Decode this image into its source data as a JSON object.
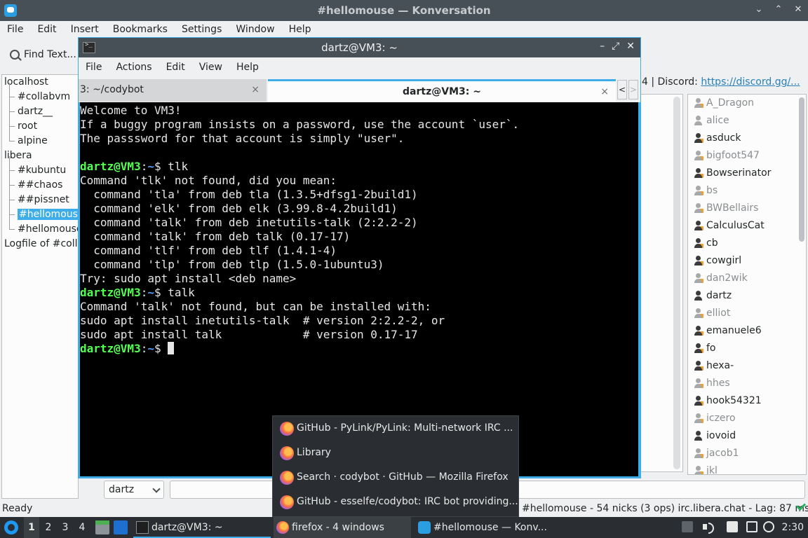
{
  "konversation": {
    "title": "#hellomouse — Konversation",
    "menu": [
      "File",
      "Edit",
      "Insert",
      "Bookmarks",
      "Settings",
      "Window",
      "Help"
    ],
    "find_text": "Find Text...",
    "tree": [
      {
        "label": "localhost",
        "level": "top"
      },
      {
        "label": "#collabvm",
        "level": "child"
      },
      {
        "label": "dartz__",
        "level": "child"
      },
      {
        "label": "root",
        "level": "child"
      },
      {
        "label": "alpine",
        "level": "child"
      },
      {
        "label": "libera",
        "level": "top"
      },
      {
        "label": "#kubuntu",
        "level": "child"
      },
      {
        "label": "##chaos",
        "level": "child"
      },
      {
        "label": "##pissnet",
        "level": "child"
      },
      {
        "label": "#hellomouse",
        "level": "child",
        "selected": true
      },
      {
        "label": "#hellomouse",
        "level": "child"
      },
      {
        "label": "Logfile of #colla",
        "level": "top"
      }
    ],
    "topic_prefix": "4 | Discord: ",
    "topic_link": "https://discord.gg/...",
    "nicks": [
      {
        "name": "A_Dragon",
        "away": true,
        "op": true
      },
      {
        "name": "alice",
        "away": true,
        "op": false
      },
      {
        "name": "asduck",
        "away": false,
        "op": true
      },
      {
        "name": "bigfoot547",
        "away": true,
        "op": true
      },
      {
        "name": "Bowserinator",
        "away": false,
        "op": true
      },
      {
        "name": "bs",
        "away": true,
        "op": true
      },
      {
        "name": "BWBellairs",
        "away": true,
        "op": true
      },
      {
        "name": "CalculusCat",
        "away": false,
        "op": true
      },
      {
        "name": "cb",
        "away": false,
        "op": true
      },
      {
        "name": "cowgirl",
        "away": false,
        "op": true
      },
      {
        "name": "dan2wik",
        "away": true,
        "op": true
      },
      {
        "name": "dartz",
        "away": false,
        "op": false
      },
      {
        "name": "elliot",
        "away": true,
        "op": true
      },
      {
        "name": "emanuele6",
        "away": false,
        "op": true
      },
      {
        "name": "fo",
        "away": false,
        "op": true
      },
      {
        "name": "hexa-",
        "away": false,
        "op": true
      },
      {
        "name": "hhes",
        "away": true,
        "op": true
      },
      {
        "name": "hook54321",
        "away": false,
        "op": true
      },
      {
        "name": "iczero",
        "away": true,
        "op": true
      },
      {
        "name": "iovoid",
        "away": false,
        "op": false
      },
      {
        "name": "jacob1",
        "away": true,
        "op": true
      },
      {
        "name": "jkl",
        "away": true,
        "op": true
      }
    ],
    "nick_combo": "dartz",
    "status_ready": "Ready",
    "status_right": "#hellomouse - 54 nicks (3 ops)  irc.libera.chat - Lag: 87 ms"
  },
  "terminal": {
    "title": "dartz@VM3: ~",
    "menu": [
      "File",
      "Actions",
      "Edit",
      "View",
      "Help"
    ],
    "tabs": [
      {
        "label": "3: ~/codybot"
      },
      {
        "label": "dartz@VM3: ~"
      }
    ],
    "tab_close": "×",
    "lines": [
      {
        "type": "text",
        "text": "Welcome to VM3!"
      },
      {
        "type": "text",
        "text": "If a buggy program insists on a password, use the account `user`."
      },
      {
        "type": "text",
        "text": "The passsword for that account is simply \"user\"."
      },
      {
        "type": "text",
        "text": ""
      },
      {
        "type": "prompt",
        "user": "dartz@VM3",
        "path": "~",
        "cmd": "$ tlk"
      },
      {
        "type": "text",
        "text": "Command 'tlk' not found, did you mean:"
      },
      {
        "type": "text",
        "text": "  command 'tla' from deb tla (1.3.5+dfsg1-2build1)"
      },
      {
        "type": "text",
        "text": "  command 'elk' from deb elk (3.99.8-4.2build1)"
      },
      {
        "type": "text",
        "text": "  command 'talk' from deb inetutils-talk (2:2.2-2)"
      },
      {
        "type": "text",
        "text": "  command 'talk' from deb talk (0.17-17)"
      },
      {
        "type": "text",
        "text": "  command 'tlf' from deb tlf (1.4.1-4)"
      },
      {
        "type": "text",
        "text": "  command 'tlp' from deb tlp (1.5.0-1ubuntu3)"
      },
      {
        "type": "text",
        "text": "Try: sudo apt install <deb name>"
      },
      {
        "type": "prompt",
        "user": "dartz@VM3",
        "path": "~",
        "cmd": "$ talk"
      },
      {
        "type": "text",
        "text": "Command 'talk' not found, but can be installed with:"
      },
      {
        "type": "text",
        "text": "sudo apt install inetutils-talk  # version 2:2.2-2, or"
      },
      {
        "type": "text",
        "text": "sudo apt install talk            # version 0.17-17"
      },
      {
        "type": "prompt",
        "user": "dartz@VM3",
        "path": "~",
        "cmd": "$ ",
        "cursor": true
      }
    ]
  },
  "firefox_popup": [
    "GitHub - PyLink/PyLink: Multi-network IRC ...",
    "Library",
    "Search · codybot · GitHub — Mozilla Firefox",
    "GitHub - esselfe/codybot: IRC bot providing..."
  ],
  "taskbar": {
    "desktops": [
      "1",
      "2",
      "3",
      "4"
    ],
    "tasks": {
      "terminal": "dartz@VM3: ~",
      "firefox": "firefox - 4 windows",
      "konversation": "#hellomouse — Konv..."
    },
    "clock": "2:30"
  },
  "colors": {
    "accent": "#3daee9",
    "prompt_user": "#54ff54",
    "prompt_path": "#5c9cff",
    "titlebar": "#475057",
    "panel": "#2a2e32"
  }
}
